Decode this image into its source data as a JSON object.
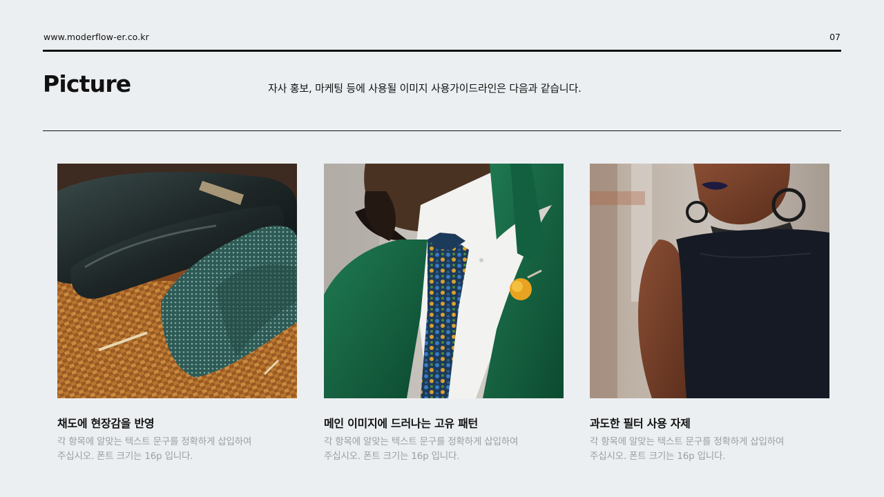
{
  "header": {
    "url": "www.moderflow-er.co.kr",
    "page_number": "07"
  },
  "section": {
    "title": "Picture",
    "intro": "자사 홍보, 마케팅 등에 사용될 이미지 사용가이드라인은 다음과 같습니다."
  },
  "cards": [
    {
      "title": "채도에 현장감을 반영",
      "desc_line1": "각 항목에 알맞는 텍스트 문구를 정확하게 삽입하여",
      "desc_line2": "주십시오. 폰트 크기는 16p 입니다."
    },
    {
      "title": "메인 이미지에 드러나는 고유 패턴",
      "desc_line1": "각 항목에 알맞는 텍스트 문구를 정확하게 삽입하여",
      "desc_line2": "주십시오. 폰트 크기는 16p 입니다."
    },
    {
      "title": "과도한 필터 사용 자제",
      "desc_line1": "각 항목에 알맞는 텍스트 문구를 정확하게 삽입하여",
      "desc_line2": "주십시오. 폰트 크기는 16p 입니다."
    }
  ]
}
